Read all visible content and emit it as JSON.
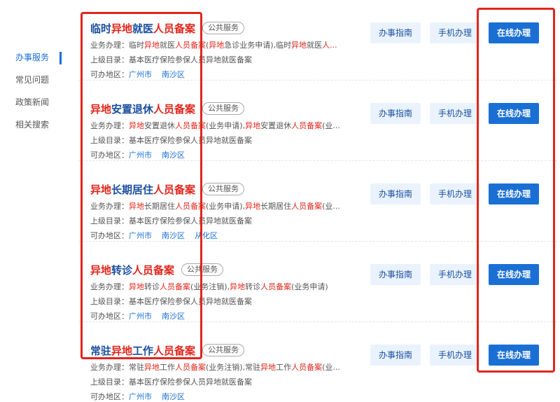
{
  "sidebar": {
    "items": [
      {
        "label": "办事服务",
        "active": true
      },
      {
        "label": "常见问题",
        "active": false
      },
      {
        "label": "政策新闻",
        "active": false
      },
      {
        "label": "相关搜索",
        "active": false
      }
    ]
  },
  "buttons": {
    "guide": "办事指南",
    "mobile": "手机办理",
    "online": "在线办理"
  },
  "tag": "公共服务",
  "labels": {
    "business": "业务办理：",
    "parent": "上级目录：",
    "area": "可办地区："
  },
  "results": [
    {
      "title": [
        {
          "t": "临时",
          "hl": false
        },
        {
          "t": "异地",
          "hl": true
        },
        {
          "t": "就医",
          "hl": false
        },
        {
          "t": "人员备案",
          "hl": true
        }
      ],
      "business": [
        {
          "t": "临时",
          "hl": false
        },
        {
          "t": "异地",
          "hl": true
        },
        {
          "t": "就医",
          "hl": false
        },
        {
          "t": "人员备案",
          "hl": true
        },
        {
          "t": "(",
          "hl": false
        },
        {
          "t": "异地",
          "hl": true
        },
        {
          "t": "急诊业务申请),临时",
          "hl": false
        },
        {
          "t": "异地",
          "hl": true
        },
        {
          "t": "就医",
          "hl": false
        },
        {
          "t": "人...",
          "hl": true
        }
      ],
      "parent": "基本医疗保险参保人员异地就医备案",
      "areas": [
        "广州市",
        "南沙区"
      ]
    },
    {
      "title": [
        {
          "t": "异地",
          "hl": true
        },
        {
          "t": "安置退休",
          "hl": false
        },
        {
          "t": "人员备案",
          "hl": true
        }
      ],
      "business": [
        {
          "t": "异地",
          "hl": true
        },
        {
          "t": "安置退休",
          "hl": false
        },
        {
          "t": "人员备案",
          "hl": true
        },
        {
          "t": "(业务申请),",
          "hl": false
        },
        {
          "t": "异地",
          "hl": true
        },
        {
          "t": "安置退休",
          "hl": false
        },
        {
          "t": "人员备案",
          "hl": true
        },
        {
          "t": "(业...",
          "hl": false
        }
      ],
      "parent": "基本医疗保险参保人员异地就医备案",
      "areas": [
        "广州市",
        "南沙区"
      ]
    },
    {
      "title": [
        {
          "t": "异地",
          "hl": true
        },
        {
          "t": "长期居住",
          "hl": false
        },
        {
          "t": "人员备案",
          "hl": true
        }
      ],
      "business": [
        {
          "t": "异地",
          "hl": true
        },
        {
          "t": "长期居住",
          "hl": false
        },
        {
          "t": "人员备案",
          "hl": true
        },
        {
          "t": "(业务申请),",
          "hl": false
        },
        {
          "t": "异地",
          "hl": true
        },
        {
          "t": "长期居住",
          "hl": false
        },
        {
          "t": "人员备案",
          "hl": true
        },
        {
          "t": "(业...",
          "hl": false
        }
      ],
      "parent": "基本医疗保险参保人员异地就医备案",
      "areas": [
        "广州市",
        "南沙区",
        "从化区"
      ]
    },
    {
      "title": [
        {
          "t": "异地",
          "hl": true
        },
        {
          "t": "转诊",
          "hl": false
        },
        {
          "t": "人员备案",
          "hl": true
        }
      ],
      "business": [
        {
          "t": "异地",
          "hl": true
        },
        {
          "t": "转诊",
          "hl": false
        },
        {
          "t": "人员备案",
          "hl": true
        },
        {
          "t": "(业务注销),",
          "hl": false
        },
        {
          "t": "异地",
          "hl": true
        },
        {
          "t": "转诊",
          "hl": false
        },
        {
          "t": "人员备案",
          "hl": true
        },
        {
          "t": "(业务申请)",
          "hl": false
        }
      ],
      "parent": "基本医疗保险参保人员异地就医备案",
      "areas": [
        "广州市",
        "南沙区"
      ]
    },
    {
      "title": [
        {
          "t": "常驻",
          "hl": false
        },
        {
          "t": "异地",
          "hl": true
        },
        {
          "t": "工作",
          "hl": false
        },
        {
          "t": "人员备案",
          "hl": true
        }
      ],
      "business": [
        {
          "t": "常驻",
          "hl": false
        },
        {
          "t": "异地",
          "hl": true
        },
        {
          "t": "工作",
          "hl": false
        },
        {
          "t": "人员备案",
          "hl": true
        },
        {
          "t": "(业务注销),常驻",
          "hl": false
        },
        {
          "t": "异地",
          "hl": true
        },
        {
          "t": "工作",
          "hl": false
        },
        {
          "t": "人员备案",
          "hl": true
        },
        {
          "t": "(业...",
          "hl": false
        }
      ],
      "parent": "基本医疗保险参保人员异地就医备案",
      "areas": [
        "广州市",
        "南沙区"
      ]
    }
  ]
}
